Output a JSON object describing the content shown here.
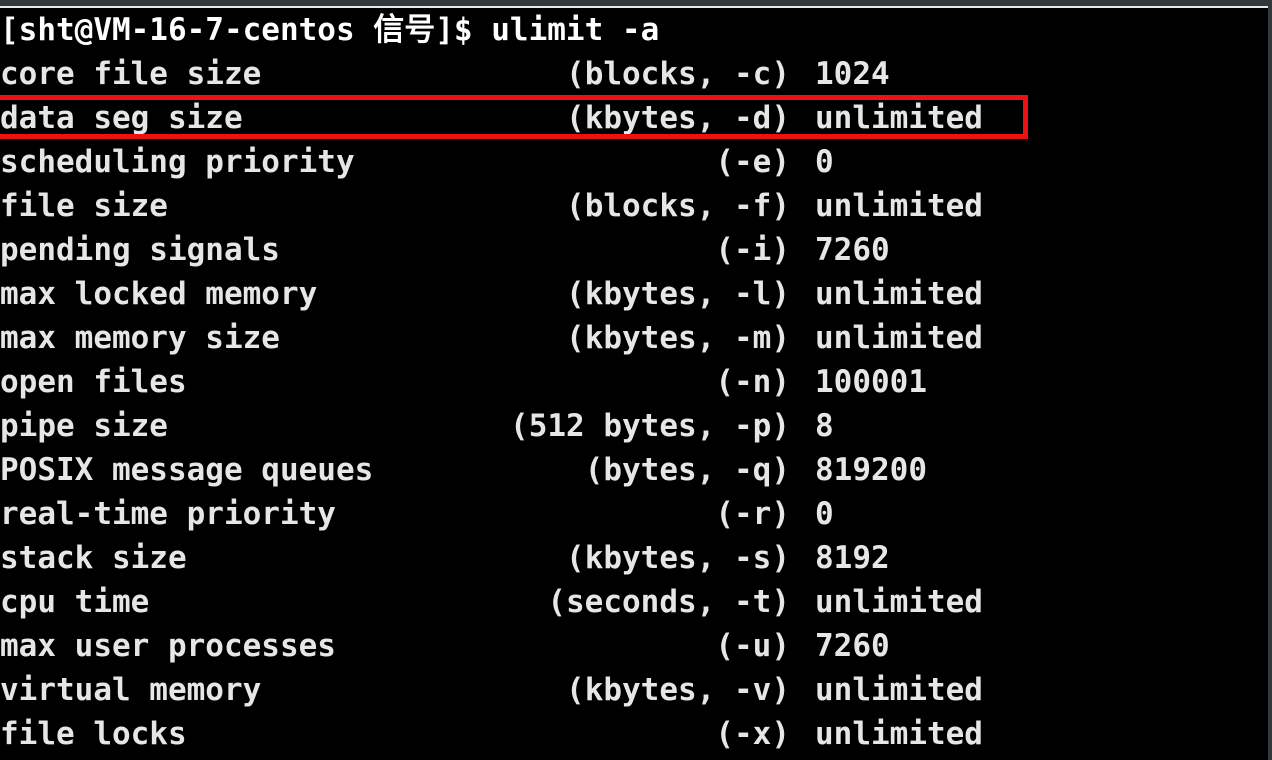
{
  "terminal": {
    "window_title": "",
    "prompt": "[sht@VM-16-7-centos 信号]$ ",
    "command": "ulimit -a",
    "full_prompt_line": "[sht@VM-16-7-centos 信号]$ ulimit -a",
    "colors": {
      "background": "#000000",
      "foreground": "#e6e6e6",
      "titlebar": "#33393b",
      "highlight": "#ee1111"
    },
    "highlight": {
      "target_row_index": 0,
      "target_row_text": "core file size              (blocks, -c) 1024",
      "color": "#ee1111"
    },
    "limits": [
      {
        "name": "core file size",
        "unit": "(blocks, -c)",
        "value": "1024"
      },
      {
        "name": "data seg size",
        "unit": "(kbytes, -d)",
        "value": "unlimited"
      },
      {
        "name": "scheduling priority",
        "unit": "(-e)",
        "value": "0"
      },
      {
        "name": "file size",
        "unit": "(blocks, -f)",
        "value": "unlimited"
      },
      {
        "name": "pending signals",
        "unit": "(-i)",
        "value": "7260"
      },
      {
        "name": "max locked memory",
        "unit": "(kbytes, -l)",
        "value": "unlimited"
      },
      {
        "name": "max memory size",
        "unit": "(kbytes, -m)",
        "value": "unlimited"
      },
      {
        "name": "open files",
        "unit": "(-n)",
        "value": "100001"
      },
      {
        "name": "pipe size",
        "unit": "(512 bytes, -p)",
        "value": "8"
      },
      {
        "name": "POSIX message queues",
        "unit": "(bytes, -q)",
        "value": "819200"
      },
      {
        "name": "real-time priority",
        "unit": "(-r)",
        "value": "0"
      },
      {
        "name": "stack size",
        "unit": "(kbytes, -s)",
        "value": "8192"
      },
      {
        "name": "cpu time",
        "unit": "(seconds, -t)",
        "value": "unlimited"
      },
      {
        "name": "max user processes",
        "unit": "(-u)",
        "value": "7260"
      },
      {
        "name": "virtual memory",
        "unit": "(kbytes, -v)",
        "value": "unlimited"
      },
      {
        "name": "file locks",
        "unit": "(-x)",
        "value": "unlimited"
      }
    ]
  }
}
